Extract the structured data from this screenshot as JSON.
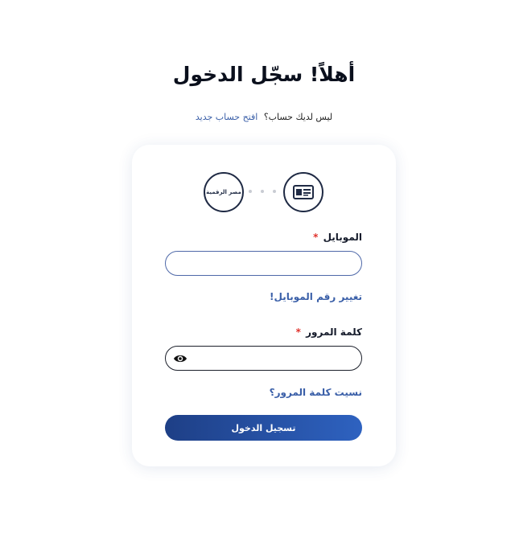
{
  "header": {
    "title": "أهلاً! سجّل الدخول",
    "no_account_text": "ليس لديك حساب؟",
    "signup_link": "افتح حساب جديد"
  },
  "stepper": {
    "step1_icon": "id-card-icon",
    "step2_label": "مصر الرقمية"
  },
  "form": {
    "mobile_label": "الموبايل",
    "required_mark": "*",
    "mobile_value": "",
    "change_mobile_link": "تغيير رقم الموبايل!",
    "password_label": "كلمة المرور",
    "password_value": "",
    "forgot_password_link": "نسيت كلمة المرور؟",
    "submit_label": "تسجيل الدخول"
  },
  "colors": {
    "accent": "#3a5fa8",
    "button_start": "#1e3f86",
    "button_end": "#2e62c0",
    "required": "#e0322c"
  }
}
